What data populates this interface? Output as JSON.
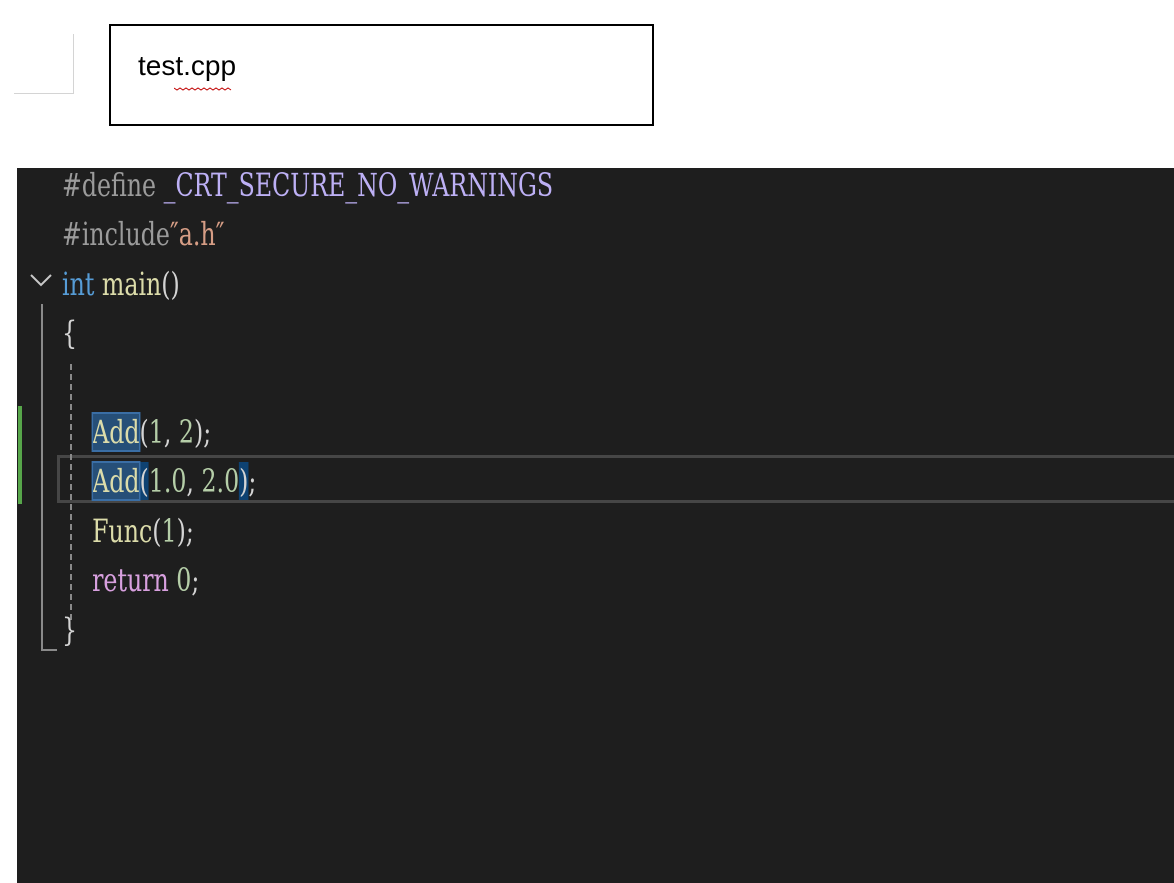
{
  "file_tab": {
    "filename": "test.cpp"
  },
  "editor": {
    "lines": [
      {
        "tokens": [
          {
            "text": "#define ",
            "kind": "preprocessor"
          },
          {
            "text": "_CRT_SECURE_NO_WARNINGS",
            "kind": "macro"
          }
        ]
      },
      {
        "tokens": [
          {
            "text": "#include",
            "kind": "preprocessor"
          },
          {
            "text": "″a.h″",
            "kind": "string"
          }
        ]
      },
      {
        "tokens": [
          {
            "text": "int",
            "kind": "keyword"
          },
          {
            "text": " main",
            "kind": "function"
          },
          {
            "text": "()",
            "kind": "punctuation"
          }
        ]
      },
      {
        "tokens": [
          {
            "text": "{",
            "kind": "punctuation"
          }
        ]
      },
      {
        "tokens": []
      },
      {
        "tokens": [
          {
            "text": "    ",
            "kind": "whitespace"
          },
          {
            "text": "Add",
            "kind": "function",
            "highlight": "reference"
          },
          {
            "text": "(",
            "kind": "punctuation"
          },
          {
            "text": "1",
            "kind": "number"
          },
          {
            "text": ", ",
            "kind": "punctuation"
          },
          {
            "text": "2",
            "kind": "number"
          },
          {
            "text": ");",
            "kind": "punctuation"
          }
        ]
      },
      {
        "tokens": [
          {
            "text": "    ",
            "kind": "whitespace"
          },
          {
            "text": "Add",
            "kind": "function",
            "highlight": "reference"
          },
          {
            "text": "(",
            "kind": "punctuation",
            "highlight": "brace"
          },
          {
            "text": "1.0",
            "kind": "number"
          },
          {
            "text": ", ",
            "kind": "punctuation"
          },
          {
            "text": "2.0",
            "kind": "number"
          },
          {
            "text": ")",
            "kind": "punctuation",
            "highlight": "brace"
          },
          {
            "text": ";",
            "kind": "punctuation"
          }
        ]
      },
      {
        "tokens": [
          {
            "text": "    ",
            "kind": "whitespace"
          },
          {
            "text": "Func",
            "kind": "function"
          },
          {
            "text": "(",
            "kind": "punctuation"
          },
          {
            "text": "1",
            "kind": "number"
          },
          {
            "text": ");",
            "kind": "punctuation"
          }
        ]
      },
      {
        "tokens": [
          {
            "text": "    ",
            "kind": "whitespace"
          },
          {
            "text": "return",
            "kind": "control-keyword"
          },
          {
            "text": " 0",
            "kind": "number"
          },
          {
            "text": ";",
            "kind": "punctuation"
          }
        ]
      },
      {
        "tokens": [
          {
            "text": "}",
            "kind": "punctuation"
          }
        ]
      }
    ],
    "current_line": 7,
    "colors": {
      "background": "#1e1e1e",
      "preprocessor": "#9b9b9b",
      "macro": "#bdb0f5",
      "string": "#d69d85",
      "keyword": "#569cd6",
      "function": "#dcdcaa",
      "number": "#b5cea8",
      "control-keyword": "#d8a0df",
      "reference_highlight": "#264f78",
      "change_bar": "#57a64a"
    },
    "icons": {
      "fold": "chevron-down-icon"
    }
  }
}
